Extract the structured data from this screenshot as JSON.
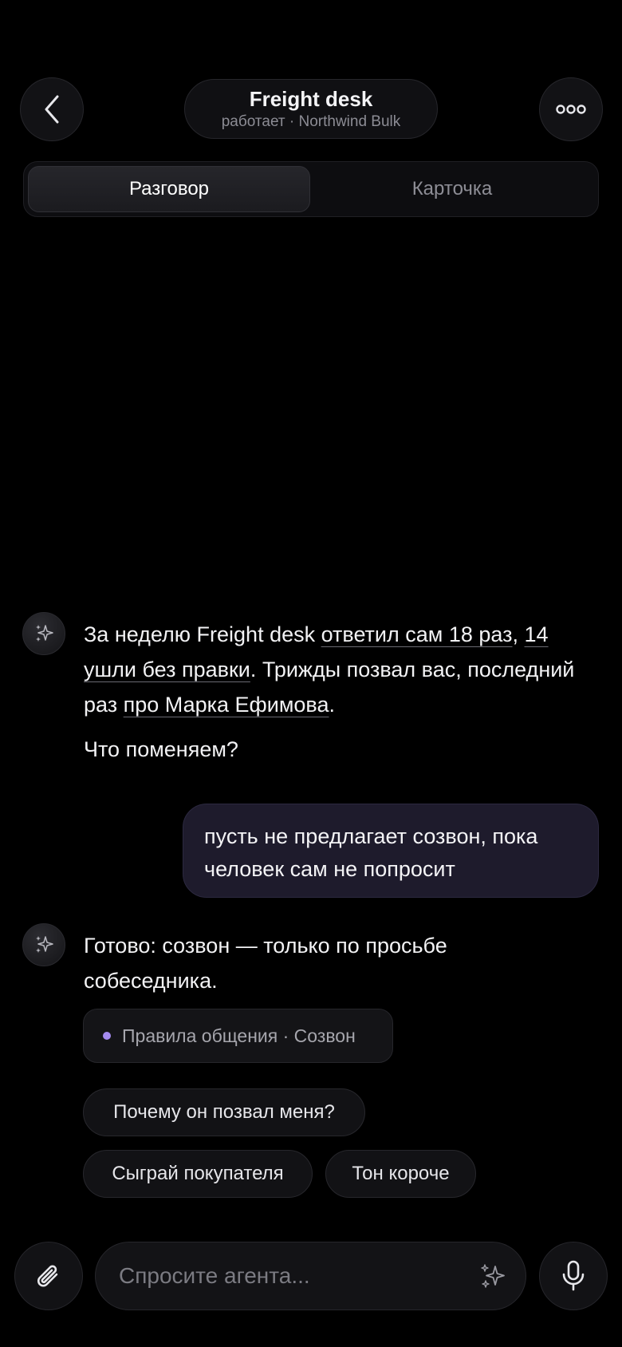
{
  "header": {
    "title": "Freight desk",
    "subtitle": "работает · Northwind Bulk"
  },
  "tabs": {
    "active": "Разговор",
    "inactive": "Карточка"
  },
  "messages": {
    "agent1": {
      "p1": "За неделю Freight desk ",
      "link1": "ответил сам 18 раз",
      "p2": ", ",
      "link2": "14 ушли без правки",
      "p3": ". Трижды позвал вас, последний раз ",
      "link3": "про Марка Ефимова",
      "p4": ".",
      "question": "Что поменяем?"
    },
    "user1": "пусть не предлагает созвон, пока человек сам не попросит",
    "agent2": "Готово: созвон — только по просьбе собеседника.",
    "tag": "Правила общения · Созвон"
  },
  "suggestions": [
    "Почему он позвал меня?",
    "Сыграй покупателя",
    "Тон короче"
  ],
  "composer": {
    "placeholder": "Спросите агента..."
  },
  "icons": {
    "back": "chevron-left-icon",
    "more": "ellipsis-icon",
    "agent": "sparkles-icon",
    "attach": "paperclip-icon",
    "mic": "microphone-icon"
  },
  "colors": {
    "background": "#000000",
    "user_bubble": "#1e1b2c",
    "tag_dot": "#a58bf0"
  }
}
